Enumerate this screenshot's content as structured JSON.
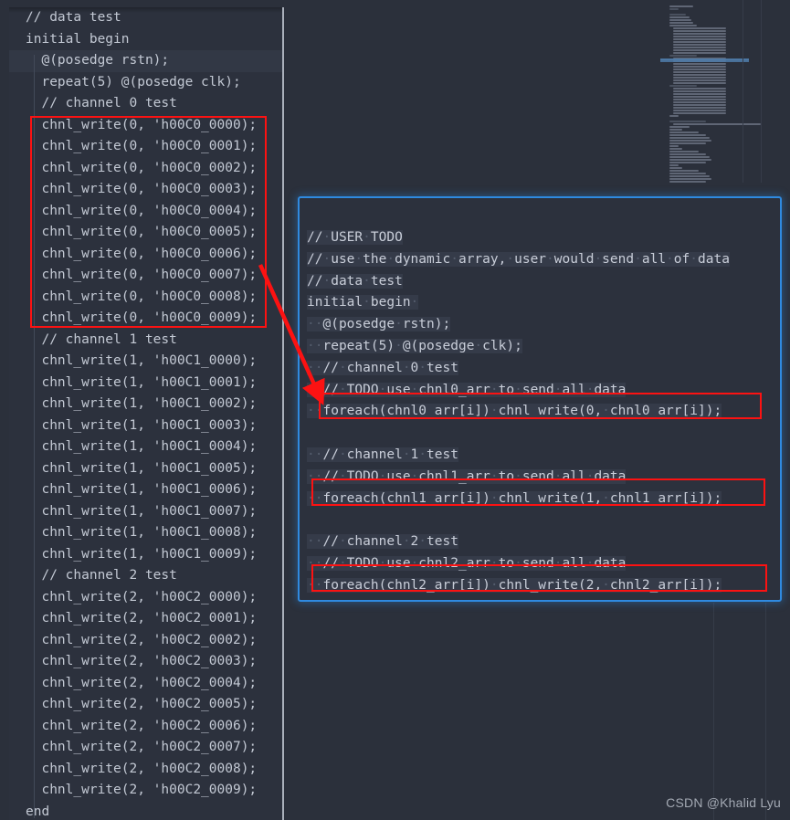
{
  "colors": {
    "editor_background": "#2c313d",
    "page_background": "#2b303b",
    "code_text": "#c3c9d4",
    "highlight_box_red": "#fc1212",
    "callout_border_blue": "#2f8ae0",
    "minimap_band_blue": "#4e7aa8",
    "line_highlight": "#353b49"
  },
  "left_editor": {
    "name": "original-testbench-code",
    "lines": [
      "// data test",
      "initial begin",
      "  @(posedge rstn);",
      "  repeat(5) @(posedge clk);",
      "  // channel 0 test",
      "  chnl_write(0, 'h00C0_0000);",
      "  chnl_write(0, 'h00C0_0001);",
      "  chnl_write(0, 'h00C0_0002);",
      "  chnl_write(0, 'h00C0_0003);",
      "  chnl_write(0, 'h00C0_0004);",
      "  chnl_write(0, 'h00C0_0005);",
      "  chnl_write(0, 'h00C0_0006);",
      "  chnl_write(0, 'h00C0_0007);",
      "  chnl_write(0, 'h00C0_0008);",
      "  chnl_write(0, 'h00C0_0009);",
      "  // channel 1 test",
      "  chnl_write(1, 'h00C1_0000);",
      "  chnl_write(1, 'h00C1_0001);",
      "  chnl_write(1, 'h00C1_0002);",
      "  chnl_write(1, 'h00C1_0003);",
      "  chnl_write(1, 'h00C1_0004);",
      "  chnl_write(1, 'h00C1_0005);",
      "  chnl_write(1, 'h00C1_0006);",
      "  chnl_write(1, 'h00C1_0007);",
      "  chnl_write(1, 'h00C1_0008);",
      "  chnl_write(1, 'h00C1_0009);",
      "  // channel 2 test",
      "  chnl_write(2, 'h00C2_0000);",
      "  chnl_write(2, 'h00C2_0001);",
      "  chnl_write(2, 'h00C2_0002);",
      "  chnl_write(2, 'h00C2_0003);",
      "  chnl_write(2, 'h00C2_0004);",
      "  chnl_write(2, 'h00C2_0005);",
      "  chnl_write(2, 'h00C2_0006);",
      "  chnl_write(2, 'h00C2_0007);",
      "  chnl_write(2, 'h00C2_0008);",
      "  chnl_write(2, 'h00C2_0009);",
      "end"
    ],
    "current_line_index": 2,
    "highlight_box_label": "channel-0-writes-highlight"
  },
  "callout_editor": {
    "name": "refactored-foreach-code",
    "lines": [
      "// USER TODO",
      "// use the dynamic array, user would send all of data",
      "// data test",
      "initial begin ",
      "  @(posedge rstn);",
      "  repeat(5) @(posedge clk);",
      "  // channel 0 test",
      "  // TODO use chnl0_arr to send all data",
      "  foreach(chnl0_arr[i]) chnl_write(0, chnl0_arr[i]);",
      "",
      "  // channel 1 test",
      "  // TODO use chnl1_arr to send all data",
      "  foreach(chnl1_arr[i]) chnl_write(1, chnl1_arr[i]);",
      "",
      "  // channel 2 test",
      "  // TODO use chnl2_arr to send all data",
      "  foreach(chnl2_arr[i]) chnl_write(2, chnl2_arr[i]);"
    ],
    "highlighted_line_indexes": [
      8,
      12,
      16
    ]
  },
  "annotation": {
    "arrow_name": "red-pointer-arrow",
    "arrow_from": "channel-0-writes-highlight",
    "arrow_to": "foreach-chnl0-line"
  },
  "minimap": {
    "name": "code-minimap",
    "visible_band_label": "viewport-indicator"
  },
  "watermark": {
    "text": "CSDN @Khalid Lyu"
  }
}
